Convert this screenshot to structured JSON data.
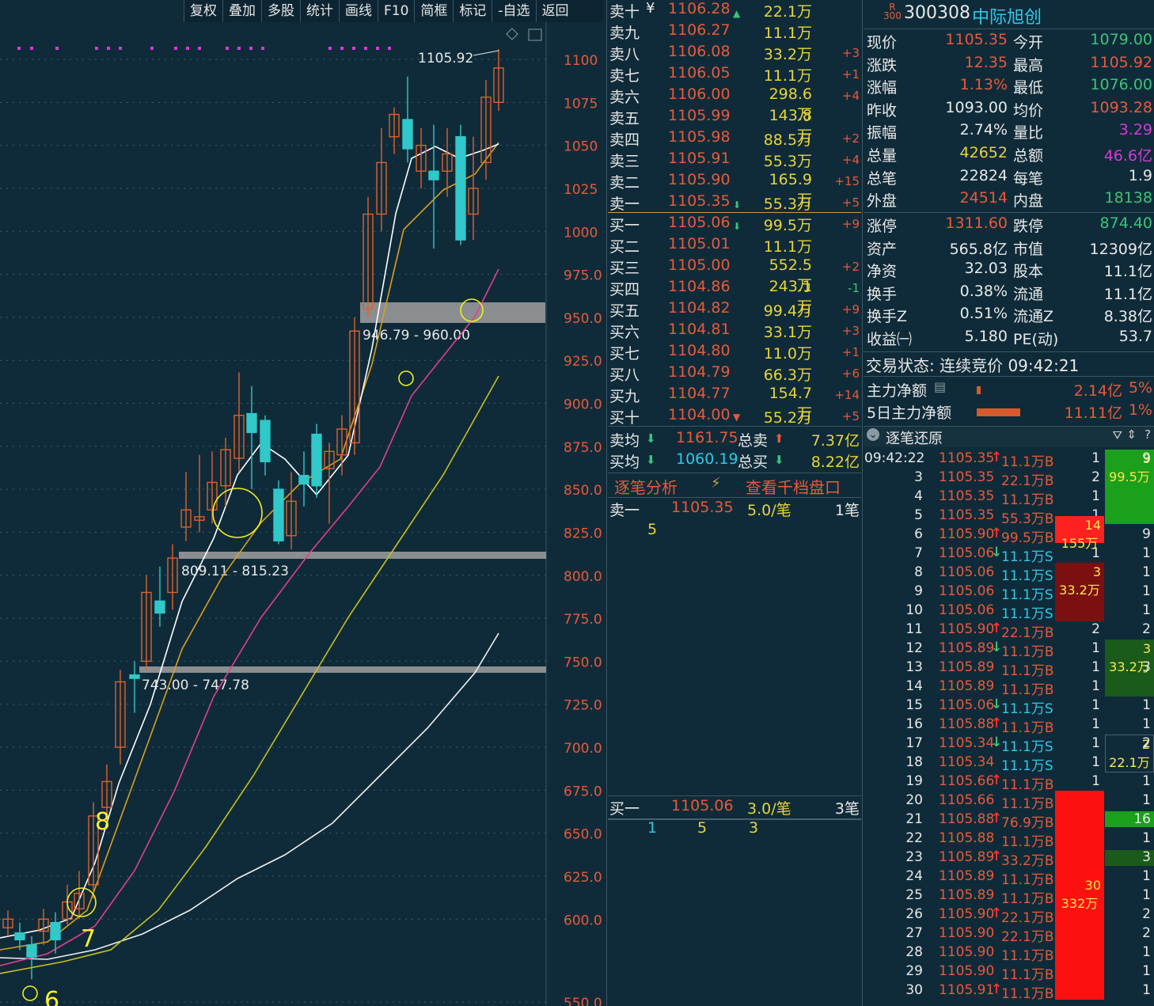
{
  "toolbar": [
    "复权",
    "叠加",
    "多股",
    "统计",
    "画线",
    "F10",
    "简框",
    "标记",
    "-自选",
    "返回"
  ],
  "chart_data": {
    "type": "candlestick",
    "y_ticks": [
      "1100",
      "1075",
      "1050",
      "1025",
      "1000",
      "975.0",
      "950.0",
      "925.0",
      "900.0",
      "875.0",
      "850.0",
      "825.0",
      "800.0",
      "775.0",
      "750.0",
      "725.0",
      "700.0",
      "675.0",
      "650.0",
      "625.0",
      "600.0",
      "550.0"
    ],
    "high_label": "1105.92",
    "zones": [
      "946.79 - 960.00",
      "809.11 - 815.23",
      "743.00 - 747.78"
    ],
    "markers": [
      "8",
      "7",
      "6"
    ]
  },
  "stock": {
    "badge": "R",
    "badge_sub": "300",
    "code": "300308",
    "name": "中际旭创"
  },
  "orderbook": {
    "asks": [
      {
        "label": "卖十",
        "price": "1106.28",
        "vol": "22.1万",
        "chg": ""
      },
      {
        "label": "卖九",
        "price": "1106.27",
        "vol": "11.1万",
        "chg": ""
      },
      {
        "label": "卖八",
        "price": "1106.08",
        "vol": "33.2万",
        "chg": "+3"
      },
      {
        "label": "卖七",
        "price": "1106.05",
        "vol": "11.1万",
        "chg": "+1"
      },
      {
        "label": "卖六",
        "price": "1106.00",
        "vol": "298.6万",
        "chg": "+4"
      },
      {
        "label": "卖五",
        "price": "1105.99",
        "vol": "143.8万",
        "chg": ""
      },
      {
        "label": "卖四",
        "price": "1105.98",
        "vol": "88.5万",
        "chg": "+2"
      },
      {
        "label": "卖三",
        "price": "1105.91",
        "vol": "55.3万",
        "chg": "+4"
      },
      {
        "label": "卖二",
        "price": "1105.90",
        "vol": "165.9万",
        "chg": "+15"
      },
      {
        "label": "卖一",
        "price": "1105.35",
        "vol": "55.3万",
        "chg": "+5"
      }
    ],
    "bids": [
      {
        "label": "买一",
        "price": "1105.06",
        "vol": "99.5万",
        "chg": "+9"
      },
      {
        "label": "买二",
        "price": "1105.01",
        "vol": "11.1万",
        "chg": ""
      },
      {
        "label": "买三",
        "price": "1105.00",
        "vol": "552.5万",
        "chg": "+2"
      },
      {
        "label": "买四",
        "price": "1104.86",
        "vol": "243.1万",
        "chg": "-1"
      },
      {
        "label": "买五",
        "price": "1104.82",
        "vol": "99.4万",
        "chg": "+9"
      },
      {
        "label": "买六",
        "price": "1104.81",
        "vol": "33.1万",
        "chg": "+3"
      },
      {
        "label": "买七",
        "price": "1104.80",
        "vol": "11.0万",
        "chg": "+1"
      },
      {
        "label": "买八",
        "price": "1104.79",
        "vol": "66.3万",
        "chg": "+6"
      },
      {
        "label": "买九",
        "price": "1104.77",
        "vol": "154.7万",
        "chg": "+14"
      },
      {
        "label": "买十",
        "price": "1104.00",
        "vol": "55.2万",
        "chg": "+5"
      }
    ],
    "ask_avg_label": "卖均",
    "ask_avg": "1161.75",
    "total_sell_label": "总卖",
    "total_sell": "7.37亿",
    "bid_avg_label": "买均",
    "bid_avg": "1060.19",
    "total_buy_label": "总买",
    "total_buy": "8.22亿",
    "analysis_tab": "逐笔分析",
    "queue_tab": "查看千档盘口",
    "ask_queue": {
      "label": "卖一",
      "price": "1105.35",
      "per": "5.0/笔",
      "count": "1笔",
      "items": [
        "5"
      ]
    },
    "bid_queue": {
      "label": "买一",
      "price": "1105.06",
      "per": "3.0/笔",
      "count": "3笔",
      "items": [
        "1",
        "5",
        "3"
      ]
    }
  },
  "quote": [
    {
      "l1": "现价",
      "v1": "1105.35",
      "c1": "red",
      "l2": "今开",
      "v2": "1079.00",
      "c2": "grn"
    },
    {
      "l1": "涨跌",
      "v1": "12.35",
      "c1": "red",
      "l2": "最高",
      "v2": "1105.92",
      "c2": "red"
    },
    {
      "l1": "涨幅",
      "v1": "1.13%",
      "c1": "red",
      "l2": "最低",
      "v2": "1076.00",
      "c2": "grn"
    },
    {
      "l1": "昨收",
      "v1": "1093.00",
      "c1": "wht",
      "l2": "均价",
      "v2": "1093.28",
      "c2": "red"
    },
    {
      "l1": "振幅",
      "v1": "2.74%",
      "c1": "wht",
      "l2": "量比",
      "v2": "3.29",
      "c2": "mag"
    },
    {
      "l1": "总量",
      "v1": "42652",
      "c1": "yel",
      "l2": "总额",
      "v2": "46.6亿",
      "c2": "mag"
    },
    {
      "l1": "总笔",
      "v1": "22824",
      "c1": "wht",
      "l2": "每笔",
      "v2": "1.9",
      "c2": "wht"
    },
    {
      "l1": "外盘",
      "v1": "24514",
      "c1": "red",
      "l2": "内盘",
      "v2": "18138",
      "c2": "grn"
    },
    {
      "l1": "涨停",
      "v1": "1311.60",
      "c1": "red",
      "l2": "跌停",
      "v2": "874.40",
      "c2": "grn"
    },
    {
      "l1": "资产",
      "v1": "565.8亿",
      "c1": "wht",
      "l2": "市值",
      "v2": "12309亿",
      "c2": "wht"
    },
    {
      "l1": "净资",
      "v1": "32.03",
      "c1": "wht",
      "l2": "股本",
      "v2": "11.1亿",
      "c2": "wht"
    },
    {
      "l1": "换手",
      "v1": "0.38%",
      "c1": "wht",
      "l2": "流通",
      "v2": "11.1亿",
      "c2": "wht"
    },
    {
      "l1": "换手Z",
      "v1": "0.51%",
      "c1": "wht",
      "l2": "流通Z",
      "v2": "8.38亿",
      "c2": "wht"
    },
    {
      "l1": "收益㈠",
      "v1": "5.180",
      "c1": "wht",
      "l2": "PE(动)",
      "v2": "53.7",
      "c2": "wht"
    }
  ],
  "trade_status": "交易状态: 连续竞价 09:42:21",
  "capital": [
    {
      "label": "主力净额",
      "value": "2.14亿",
      "pct": "5%",
      "bar": 0.05
    },
    {
      "label": "5日主力净额",
      "value": "11.11亿",
      "pct": "1%",
      "bar": 0.55
    }
  ],
  "ticks_header": "逐笔还原",
  "ticks": [
    {
      "t": "09:42:22",
      "p": "1105.35",
      "a": "up",
      "v": "11.1万B",
      "n": "1"
    },
    {
      "t": "3",
      "p": "1105.35",
      "a": "",
      "v": "22.1万B",
      "n": "2"
    },
    {
      "t": "4",
      "p": "1105.35",
      "a": "",
      "v": "11.1万B",
      "n": "1"
    },
    {
      "t": "5",
      "p": "1105.35",
      "a": "",
      "v": "55.3万B",
      "n": "1"
    },
    {
      "t": "6",
      "p": "1105.90",
      "a": "up",
      "v": "99.5万B",
      "n": "9"
    },
    {
      "t": "7",
      "p": "1105.06",
      "a": "dn",
      "v": "11.1万S",
      "n": "1"
    },
    {
      "t": "8",
      "p": "1105.06",
      "a": "",
      "v": "11.1万S",
      "n": "1"
    },
    {
      "t": "9",
      "p": "1105.06",
      "a": "",
      "v": "11.1万S",
      "n": "1"
    },
    {
      "t": "10",
      "p": "1105.06",
      "a": "",
      "v": "11.1万S",
      "n": "1"
    },
    {
      "t": "11",
      "p": "1105.90",
      "a": "up",
      "v": "22.1万B",
      "n": "2"
    },
    {
      "t": "12",
      "p": "1105.89",
      "a": "dn",
      "v": "11.1万B",
      "n": "1"
    },
    {
      "t": "13",
      "p": "1105.89",
      "a": "",
      "v": "11.1万B",
      "n": "1"
    },
    {
      "t": "14",
      "p": "1105.89",
      "a": "",
      "v": "11.1万B",
      "n": "1"
    },
    {
      "t": "15",
      "p": "1105.06",
      "a": "dn",
      "v": "11.1万S",
      "n": "1"
    },
    {
      "t": "16",
      "p": "1105.88",
      "a": "up",
      "v": "11.1万B",
      "n": "1"
    },
    {
      "t": "17",
      "p": "1105.34",
      "a": "dn",
      "v": "11.1万S",
      "n": "1"
    },
    {
      "t": "18",
      "p": "1105.34",
      "a": "",
      "v": "11.1万S",
      "n": "1"
    },
    {
      "t": "19",
      "p": "1105.66",
      "a": "up",
      "v": "11.1万B",
      "n": "1"
    },
    {
      "t": "20",
      "p": "1105.66",
      "a": "",
      "v": "11.1万B",
      "n": ""
    },
    {
      "t": "21",
      "p": "1105.88",
      "a": "up",
      "v": "76.9万B",
      "n": ""
    },
    {
      "t": "22",
      "p": "1105.88",
      "a": "",
      "v": "11.1万B",
      "n": ""
    },
    {
      "t": "23",
      "p": "1105.89",
      "a": "up",
      "v": "33.2万B",
      "n": ""
    },
    {
      "t": "24",
      "p": "1105.89",
      "a": "",
      "v": "11.1万B",
      "n": ""
    },
    {
      "t": "25",
      "p": "1105.89",
      "a": "",
      "v": "11.1万B",
      "n": ""
    },
    {
      "t": "26",
      "p": "1105.90",
      "a": "up",
      "v": "22.1万B",
      "n": ""
    },
    {
      "t": "27",
      "p": "1105.90",
      "a": "",
      "v": "22.1万B",
      "n": ""
    },
    {
      "t": "28",
      "p": "1105.90",
      "a": "",
      "v": "11.1万B",
      "n": ""
    },
    {
      "t": "29",
      "p": "1105.90",
      "a": "",
      "v": "11.1万B",
      "n": ""
    },
    {
      "t": "30",
      "p": "1105.91",
      "a": "up",
      "v": "11.1万B",
      "n": ""
    }
  ],
  "tick_right_col": [
    "9",
    "",
    "",
    "",
    "9",
    "1",
    "1",
    "1",
    "1",
    "2",
    "",
    "3",
    "",
    "1",
    "1",
    "2",
    "",
    "1",
    "1",
    "16",
    "1",
    "3",
    "1",
    "1",
    "2",
    "2",
    "1",
    "1",
    "1"
  ],
  "blocks": [
    {
      "n": "14",
      "v": "155万"
    },
    {
      "n": "3",
      "v": "33.2万"
    },
    {
      "n": "30",
      "v": "332万"
    },
    {
      "n": "9",
      "v": "99.5万"
    },
    {
      "n": "3",
      "v": "33.2万"
    },
    {
      "n": "2",
      "v": "22.1万"
    }
  ]
}
